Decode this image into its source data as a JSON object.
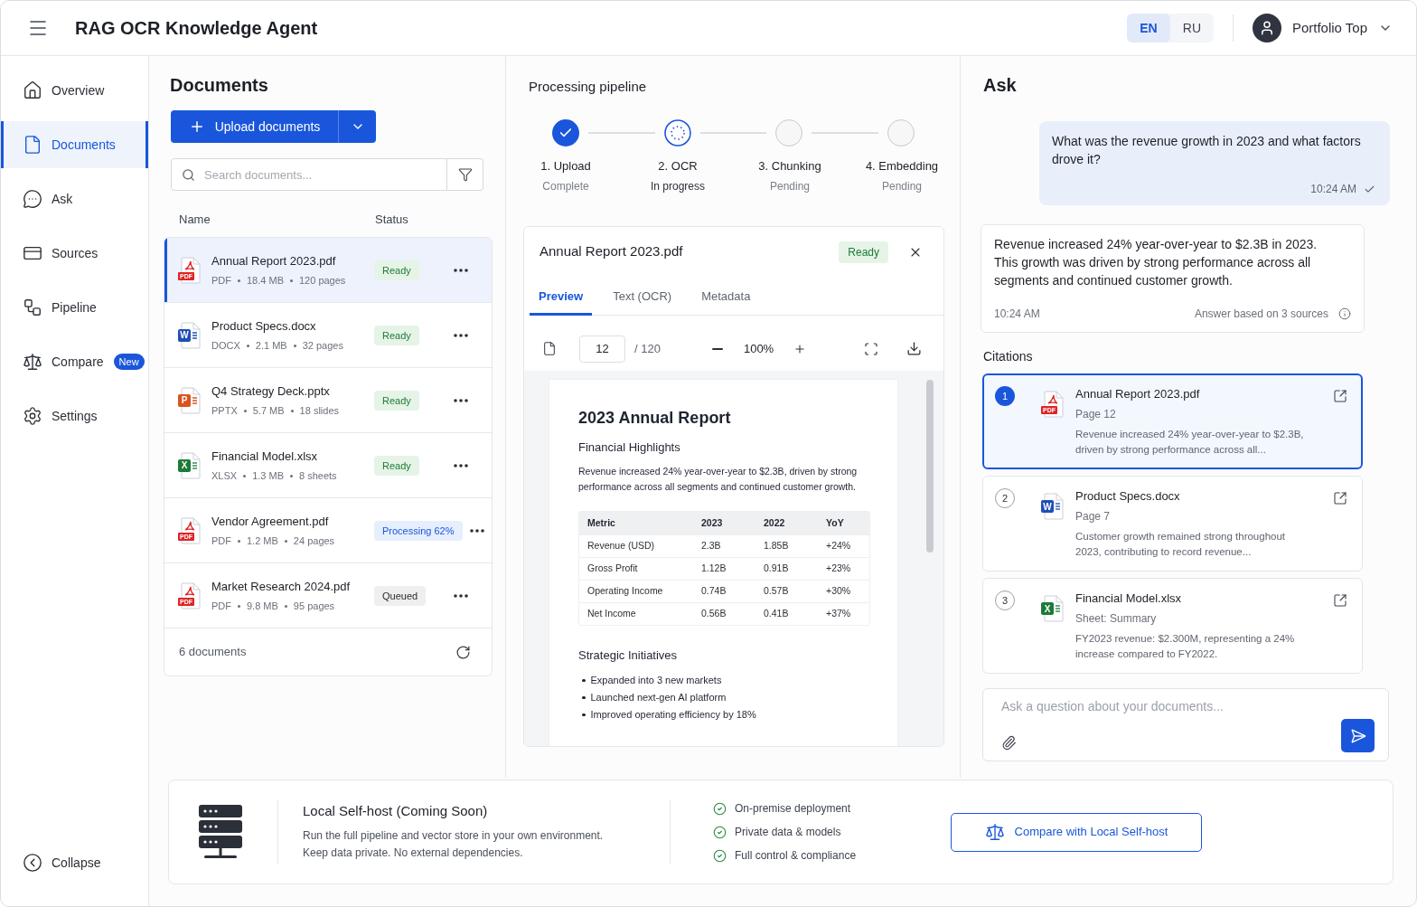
{
  "header": {
    "title": "RAG OCR Knowledge Agent",
    "languages": [
      {
        "label": "EN",
        "selected": true
      },
      {
        "label": "RU",
        "selected": false
      }
    ],
    "user": "Portfolio Top"
  },
  "sidebar": {
    "items": [
      {
        "label": "Overview",
        "selected": false
      },
      {
        "label": "Documents",
        "selected": true
      },
      {
        "label": "Ask",
        "selected": false
      },
      {
        "label": "Sources",
        "selected": false
      },
      {
        "label": "Pipeline",
        "selected": false
      },
      {
        "label": "Compare",
        "selected": false,
        "badge": "New"
      },
      {
        "label": "Settings",
        "selected": false
      }
    ],
    "collapse": "Collapse"
  },
  "documents": {
    "title": "Documents",
    "upload_button": "Upload documents",
    "search": {
      "placeholder": "Search documents..."
    },
    "columns": [
      "Name",
      "Status"
    ],
    "rows": [
      {
        "name": "Annual Report 2023.pdf",
        "kind": "pdf",
        "icon_text": "PDF",
        "type": "PDF",
        "size": "18.4 MB",
        "extent": "120 pages",
        "status": {
          "label": "Ready",
          "kind": "ready"
        },
        "selected": true
      },
      {
        "name": "Product Specs.docx",
        "kind": "docx",
        "icon_text": "W",
        "type": "DOCX",
        "size": "2.1 MB",
        "extent": "32 pages",
        "status": {
          "label": "Ready",
          "kind": "ready"
        },
        "selected": false
      },
      {
        "name": "Q4 Strategy Deck.pptx",
        "kind": "pptx",
        "icon_text": "P",
        "type": "PPTX",
        "size": "5.7 MB",
        "extent": "18 slides",
        "status": {
          "label": "Ready",
          "kind": "ready"
        },
        "selected": false
      },
      {
        "name": "Financial Model.xlsx",
        "kind": "xlsx",
        "icon_text": "X",
        "type": "XLSX",
        "size": "1.3 MB",
        "extent": "8 sheets",
        "status": {
          "label": "Ready",
          "kind": "ready"
        },
        "selected": false
      },
      {
        "name": "Vendor Agreement.pdf",
        "kind": "pdf",
        "icon_text": "PDF",
        "type": "PDF",
        "size": "1.2 MB",
        "extent": "24 pages",
        "status": {
          "label": "Processing 62%",
          "kind": "processing"
        },
        "selected": false
      },
      {
        "name": "Market Research 2024.pdf",
        "kind": "pdf",
        "icon_text": "PDF",
        "type": "PDF",
        "size": "9.8 MB",
        "extent": "95 pages",
        "status": {
          "label": "Queued",
          "kind": "queued"
        },
        "selected": false
      }
    ],
    "footer": "6 documents"
  },
  "pipeline": {
    "title": "Processing pipeline",
    "steps": [
      {
        "label": "1. Upload",
        "status": "Complete",
        "kind": "complete"
      },
      {
        "label": "2. OCR",
        "status": "In progress",
        "kind": "active"
      },
      {
        "label": "3. Chunking",
        "status": "Pending",
        "kind": "pending"
      },
      {
        "label": "4. Embedding",
        "status": "Pending",
        "kind": "pending"
      }
    ]
  },
  "preview": {
    "file_name": "Annual Report 2023.pdf",
    "status": {
      "label": "Ready",
      "kind": "ready"
    },
    "tabs": [
      {
        "label": "Preview",
        "selected": true
      },
      {
        "label": "Text (OCR)",
        "selected": false
      },
      {
        "label": "Metadata",
        "selected": false
      }
    ],
    "page": "12",
    "page_total": "/ 120",
    "zoom": "100%",
    "document": {
      "title": "2023 Annual Report",
      "sections": [
        {
          "heading": "Financial Highlights",
          "paragraph": "Revenue increased 24% year-over-year to $2.3B, driven by strong performance across all segments and continued customer growth.",
          "table": {
            "columns": [
              "Metric",
              "2023",
              "2022",
              "YoY"
            ],
            "rows": [
              [
                "Revenue (USD)",
                "2.3B",
                "1.85B",
                "+24%"
              ],
              [
                "Gross Profit",
                "1.12B",
                "0.91B",
                "+23%"
              ],
              [
                "Operating Income",
                "0.74B",
                "0.57B",
                "+30%"
              ],
              [
                "Net Income",
                "0.56B",
                "0.41B",
                "+37%"
              ]
            ]
          }
        },
        {
          "heading": "Strategic Initiatives",
          "bullets": [
            "Expanded into 3 new markets",
            "Launched next-gen AI platform",
            "Improved operating efficiency by 18%"
          ]
        }
      ]
    }
  },
  "ask": {
    "title": "Ask",
    "question": {
      "text": "What was the revenue growth in 2023 and what factors drove it?",
      "time": "10:24 AM",
      "delivered": true
    },
    "answer": {
      "text": "Revenue increased 24% year-over-year to $2.3B in 2023. This growth was driven by strong performance across all segments and continued customer growth.",
      "time": "10:24 AM",
      "note": "Answer based on 3 sources"
    },
    "citations_title": "Citations",
    "citations": [
      {
        "number": "1",
        "kind": "pdf",
        "icon_text": "PDF",
        "title": "Annual Report 2023.pdf",
        "location": "Page 12",
        "snippet": "Revenue increased 24% year-over-year to $2.3B, driven by strong performance across all...",
        "selected": true
      },
      {
        "number": "2",
        "kind": "docx",
        "icon_text": "W",
        "title": "Product Specs.docx",
        "location": "Page 7",
        "snippet": "Customer growth remained strong throughout 2023, contributing to record revenue...",
        "selected": false
      },
      {
        "number": "3",
        "kind": "xlsx",
        "icon_text": "X",
        "title": "Financial Model.xlsx",
        "location": "Sheet: Summary",
        "snippet": "FY2023 revenue: $2.300M, representing a 24% increase compared to FY2022.",
        "selected": false
      }
    ],
    "input": {
      "placeholder": "Ask a question about your documents..."
    }
  },
  "banner": {
    "title": "Local Self-host (Coming Soon)",
    "description": [
      "Run the full pipeline and vector store in your own environment.",
      "Keep data private. No external dependencies."
    ],
    "features": [
      "On-premise deployment",
      "Private data & models",
      "Full control & compliance"
    ],
    "button": "Compare with Local Self-host"
  }
}
